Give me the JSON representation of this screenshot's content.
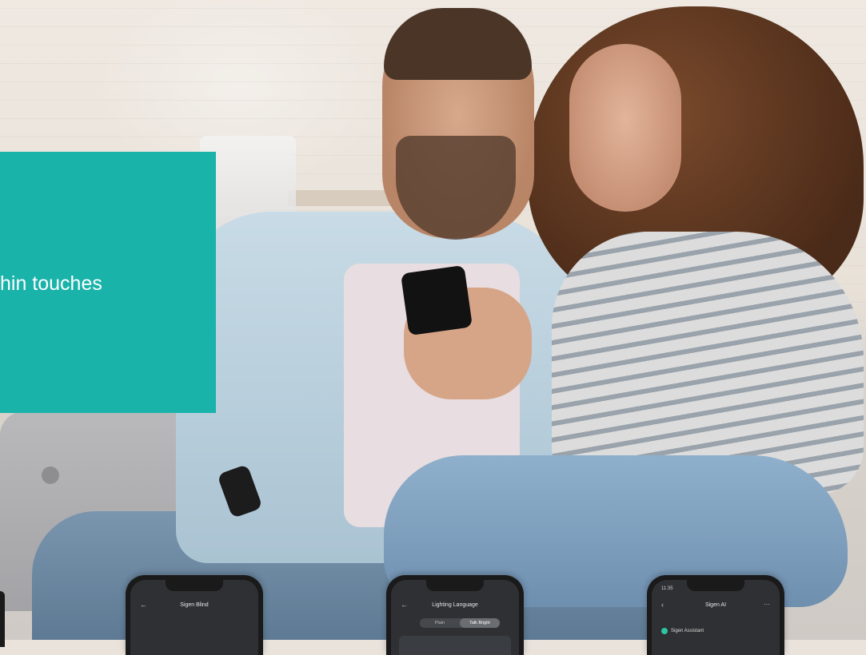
{
  "promo": {
    "text": "hin touches",
    "color": "#19b3aa"
  },
  "mockups": [
    {
      "time": "",
      "status": "",
      "title": "Sigen Blind",
      "back_icon": "arrow-left-icon"
    },
    {
      "time": "",
      "status": "",
      "title": "Lighting Language",
      "back_icon": "arrow-left-icon",
      "segments": [
        "Plain",
        "Talk Bright"
      ],
      "selected_segment": "Talk Bright"
    },
    {
      "time": "11:35",
      "status": "",
      "title": "Sigen AI",
      "back_icon": "chevron-left-icon",
      "more": "···",
      "assistant_label": "Sigen Assistant"
    }
  ]
}
